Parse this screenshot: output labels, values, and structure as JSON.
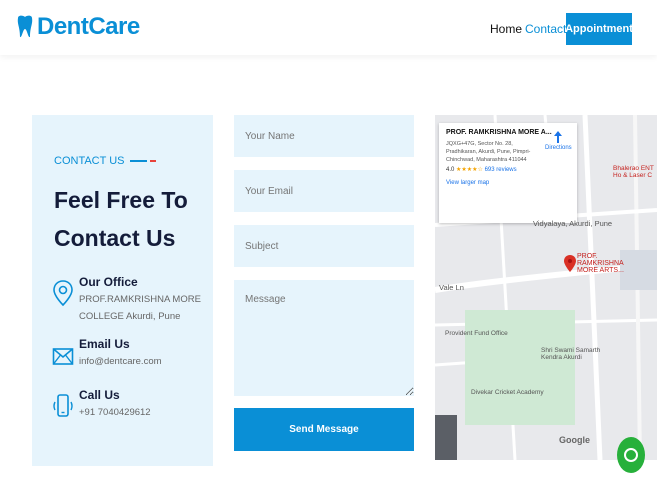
{
  "brand": {
    "name": "DentCare",
    "color": "#0a8fd6",
    "icon": "tooth-icon"
  },
  "nav": {
    "home": "Home",
    "contact": "Contact",
    "appointment": "Appointment"
  },
  "contact": {
    "eyebrow": "CONTACT US",
    "heading": "Feel Free To Contact Us",
    "office": {
      "title": "Our Office",
      "line1": "PROF.RAMKRISHNA MORE",
      "line2": "COLLEGE Akurdi, Pune",
      "icon": "location-pin-icon"
    },
    "email": {
      "title": "Email Us",
      "value": "info@dentcare.com",
      "icon": "envelope-icon"
    },
    "call": {
      "title": "Call Us",
      "value": "+91 7040429612",
      "icon": "phone-icon"
    }
  },
  "form": {
    "name_placeholder": "Your Name",
    "email_placeholder": "Your Email",
    "subject_placeholder": "Subject",
    "message_placeholder": "Message",
    "send_label": "Send Message"
  },
  "map": {
    "place_title": "PROF. RAMKRISHNA MORE A...",
    "address": "JQXG+47G, Sector No. 28, Pradhikaran, Akurdi, Pune, Pimpri-Chinchwad, Maharashtra 411044",
    "rating": "4.0",
    "stars": "★★★★☆",
    "reviews": "693 reviews",
    "larger_map": "View larger map",
    "directions": "Directions",
    "labels": {
      "bhairao": "Bhalerao ENT Ho & Laser C",
      "akurdi": "Vidyalaya, Akurdi, Pune",
      "marker": "PROF. RAMKRISHNA MORE ARTS...",
      "vale": "Vale Ln",
      "pf": "Provident Fund Office",
      "samarth": "Shri Swami Samarth Kendra Akurdi",
      "cricket": "Divekar Cricket Academy",
      "google": "Google"
    }
  }
}
